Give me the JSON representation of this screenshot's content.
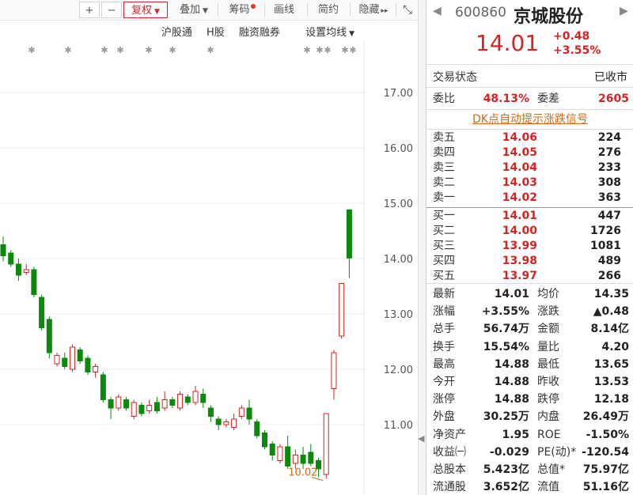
{
  "toolbar": {
    "plus": "+",
    "minus": "−",
    "fuquan": "复权",
    "diejia": "叠加",
    "chouma": "筹码",
    "huaxian": "画线",
    "jianyue": "简约",
    "yincang": "隐藏",
    "yincang_arrow": "▸▸",
    "fullscreen": "⤡"
  },
  "subbar": {
    "hugutong": "沪股通",
    "hgu": "H股",
    "rongzi": "融资融券",
    "settings": "设置均线"
  },
  "chart": {
    "y_labels": [
      "17.00",
      "16.00",
      "15.00",
      "14.00",
      "13.00",
      "12.00",
      "11.00"
    ],
    "low_annotation": "10.02",
    "up_color": "#d62323",
    "down_color": "#0a8a0a"
  },
  "chart_data": {
    "type": "candlestick",
    "ylim": [
      10.0,
      17.5
    ],
    "candles": [
      {
        "o": 14.25,
        "c": 14.05,
        "h": 14.4,
        "l": 13.95
      },
      {
        "o": 14.1,
        "c": 13.9,
        "h": 14.15,
        "l": 13.85
      },
      {
        "o": 13.9,
        "c": 13.7,
        "h": 14.0,
        "l": 13.6
      },
      {
        "o": 13.75,
        "c": 13.8,
        "h": 13.9,
        "l": 13.7
      },
      {
        "o": 13.8,
        "c": 13.35,
        "h": 13.85,
        "l": 13.3
      },
      {
        "o": 13.3,
        "c": 12.75,
        "h": 13.35,
        "l": 12.7
      },
      {
        "o": 12.9,
        "c": 12.3,
        "h": 12.95,
        "l": 12.2
      },
      {
        "o": 12.1,
        "c": 12.25,
        "h": 12.3,
        "l": 12.05
      },
      {
        "o": 12.2,
        "c": 12.05,
        "h": 12.3,
        "l": 12.0
      },
      {
        "o": 12.0,
        "c": 12.4,
        "h": 12.45,
        "l": 11.95
      },
      {
        "o": 12.35,
        "c": 12.15,
        "h": 12.4,
        "l": 12.1
      },
      {
        "o": 12.2,
        "c": 11.95,
        "h": 12.25,
        "l": 11.9
      },
      {
        "o": 11.95,
        "c": 12.05,
        "h": 12.1,
        "l": 11.85
      },
      {
        "o": 11.9,
        "c": 11.45,
        "h": 11.95,
        "l": 11.4
      },
      {
        "o": 11.45,
        "c": 11.3,
        "h": 11.5,
        "l": 11.1
      },
      {
        "o": 11.3,
        "c": 11.5,
        "h": 11.55,
        "l": 11.25
      },
      {
        "o": 11.45,
        "c": 11.3,
        "h": 11.5,
        "l": 11.25
      },
      {
        "o": 11.15,
        "c": 11.4,
        "h": 11.45,
        "l": 11.1
      },
      {
        "o": 11.35,
        "c": 11.2,
        "h": 11.4,
        "l": 11.15
      },
      {
        "o": 11.25,
        "c": 11.35,
        "h": 11.45,
        "l": 11.2
      },
      {
        "o": 11.4,
        "c": 11.25,
        "h": 11.5,
        "l": 11.2
      },
      {
        "o": 11.3,
        "c": 11.45,
        "h": 11.6,
        "l": 11.25
      },
      {
        "o": 11.45,
        "c": 11.35,
        "h": 11.5,
        "l": 11.3
      },
      {
        "o": 11.3,
        "c": 11.55,
        "h": 11.6,
        "l": 11.25
      },
      {
        "o": 11.5,
        "c": 11.4,
        "h": 11.55,
        "l": 11.35
      },
      {
        "o": 11.4,
        "c": 11.6,
        "h": 11.7,
        "l": 11.35
      },
      {
        "o": 11.55,
        "c": 11.4,
        "h": 11.65,
        "l": 11.3
      },
      {
        "o": 11.3,
        "c": 11.15,
        "h": 11.35,
        "l": 11.05
      },
      {
        "o": 11.1,
        "c": 11.0,
        "h": 11.15,
        "l": 10.9
      },
      {
        "o": 11.0,
        "c": 11.05,
        "h": 11.1,
        "l": 10.95
      },
      {
        "o": 10.95,
        "c": 11.1,
        "h": 11.2,
        "l": 10.9
      },
      {
        "o": 11.15,
        "c": 11.3,
        "h": 11.35,
        "l": 11.1
      },
      {
        "o": 11.3,
        "c": 11.1,
        "h": 11.45,
        "l": 11.0
      },
      {
        "o": 11.05,
        "c": 10.8,
        "h": 11.1,
        "l": 10.75
      },
      {
        "o": 10.85,
        "c": 10.6,
        "h": 10.9,
        "l": 10.55
      },
      {
        "o": 10.65,
        "c": 10.45,
        "h": 10.7,
        "l": 10.35
      },
      {
        "o": 10.35,
        "c": 10.6,
        "h": 10.65,
        "l": 10.3
      },
      {
        "o": 10.6,
        "c": 10.25,
        "h": 10.8,
        "l": 10.2
      },
      {
        "o": 10.3,
        "c": 10.45,
        "h": 10.55,
        "l": 10.2
      },
      {
        "o": 10.45,
        "c": 10.3,
        "h": 10.6,
        "l": 10.2
      },
      {
        "o": 10.5,
        "c": 10.3,
        "h": 10.65,
        "l": 10.25
      },
      {
        "o": 10.35,
        "c": 10.2,
        "h": 10.4,
        "l": 10.05
      },
      {
        "o": 10.1,
        "c": 11.2,
        "h": 11.2,
        "l": 10.02
      },
      {
        "o": 11.65,
        "c": 12.3,
        "h": 12.35,
        "l": 11.45
      },
      {
        "o": 12.6,
        "c": 13.55,
        "h": 13.55,
        "l": 12.55
      },
      {
        "o": 14.88,
        "c": 14.01,
        "h": 14.88,
        "l": 13.65
      }
    ]
  },
  "quote": {
    "code": "600860",
    "name": "京城股份",
    "price": "14.01",
    "change": "+0.48",
    "change_pct": "+3.55%",
    "nav_prev": "◀",
    "nav_next": "▶",
    "trade_status_label": "交易状态",
    "trade_status_value": "已收市",
    "weibi_label": "委比",
    "weibi_value": "48.13%",
    "weicha_label": "委差",
    "weicha_value": "2605",
    "dk_link": "DK点自动提示涨跌信号"
  },
  "orderbook": {
    "asks": [
      {
        "label": "卖五",
        "price": "14.06",
        "vol": "224"
      },
      {
        "label": "卖四",
        "price": "14.05",
        "vol": "276"
      },
      {
        "label": "卖三",
        "price": "14.04",
        "vol": "233"
      },
      {
        "label": "卖二",
        "price": "14.03",
        "vol": "308"
      },
      {
        "label": "卖一",
        "price": "14.02",
        "vol": "363"
      }
    ],
    "bids": [
      {
        "label": "买一",
        "price": "14.01",
        "vol": "447"
      },
      {
        "label": "买二",
        "price": "14.00",
        "vol": "1726"
      },
      {
        "label": "买三",
        "price": "13.99",
        "vol": "1081"
      },
      {
        "label": "买四",
        "price": "13.98",
        "vol": "489"
      },
      {
        "label": "买五",
        "price": "13.97",
        "vol": "266"
      }
    ]
  },
  "stats": [
    {
      "l1": "最新",
      "v1": "14.01",
      "c1": "red",
      "l2": "均价",
      "v2": "14.35",
      "c2": "red"
    },
    {
      "l1": "涨幅",
      "v1": "+3.55%",
      "c1": "red",
      "l2": "涨跌",
      "v2": "▲0.48",
      "c2": "red"
    },
    {
      "l1": "总手",
      "v1": "56.74万",
      "c1": "",
      "l2": "金额",
      "v2": "8.14亿",
      "c2": "blue"
    },
    {
      "l1": "换手",
      "v1": "15.54%",
      "c1": "",
      "l2": "量比",
      "v2": "4.20",
      "c2": "red"
    },
    {
      "l1": "最高",
      "v1": "14.88",
      "c1": "red",
      "l2": "最低",
      "v2": "13.65",
      "c2": "red"
    },
    {
      "l1": "今开",
      "v1": "14.88",
      "c1": "red",
      "l2": "昨收",
      "v2": "13.53",
      "c2": ""
    },
    {
      "l1": "涨停",
      "v1": "14.88",
      "c1": "red",
      "l2": "跌停",
      "v2": "12.18",
      "c2": "green"
    },
    {
      "l1": "外盘",
      "v1": "30.25万",
      "c1": "red",
      "l2": "内盘",
      "v2": "26.49万",
      "c2": "green"
    },
    {
      "l1": "净资产",
      "v1": "1.95",
      "c1": "",
      "l2": "ROE",
      "v2": "-1.50%",
      "c2": ""
    },
    {
      "l1": "收益㈠",
      "v1": "-0.029",
      "c1": "",
      "l2": "PE(动)*",
      "v2": "-120.54",
      "c2": ""
    },
    {
      "l1": "总股本",
      "v1": "5.423亿",
      "c1": "",
      "l2": "总值*",
      "v2": "75.97亿",
      "c2": ""
    },
    {
      "l1": "流通股",
      "v1": "3.652亿",
      "c1": "",
      "l2": "流值",
      "v2": "51.16亿",
      "c2": ""
    }
  ]
}
